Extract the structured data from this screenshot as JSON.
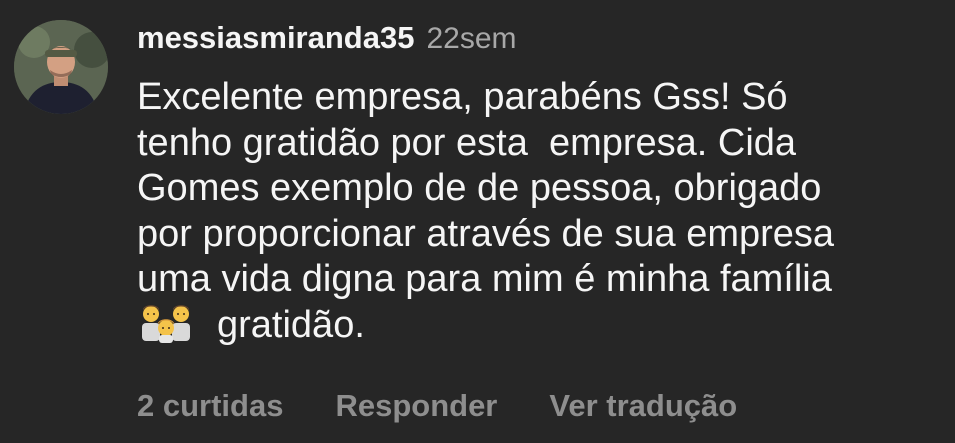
{
  "comment": {
    "username": "messiasmiranda35",
    "time": "22sem",
    "lines": [
      "Excelente empresa, parabéns Gss! Só",
      "tenho gratidão por esta  empresa. Cida",
      "Gomes exemplo de de pessoa, obrigado",
      "por proporcionar através de sua empresa",
      "uma vida digna para mim é minha família"
    ],
    "last_line_text": "gratidão.",
    "emoji": "family-two-men-one-boy-emoji",
    "avatar_icon": "user-avatar-photo"
  },
  "actions": {
    "likes": "2 curtidas",
    "reply": "Responder",
    "translate": "Ver tradução"
  }
}
